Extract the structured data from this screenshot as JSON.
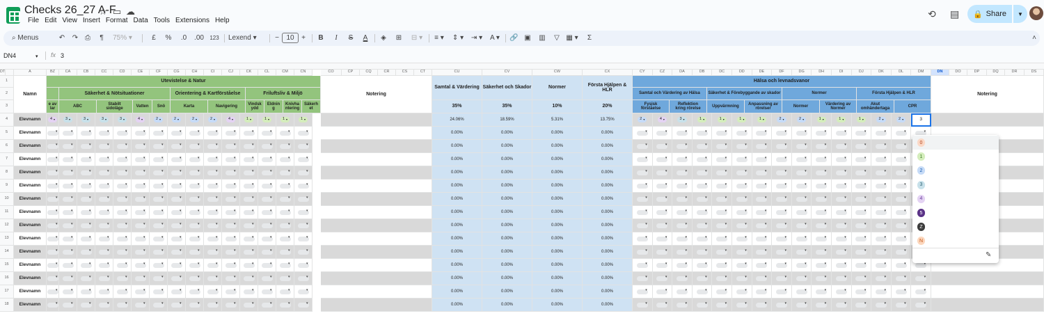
{
  "app": {
    "title": "Checks 26_27 A-F",
    "menus": [
      "File",
      "Edit",
      "View",
      "Insert",
      "Format",
      "Data",
      "Tools",
      "Extensions",
      "Help"
    ],
    "share_label": "Share"
  },
  "toolbar": {
    "search_label": "Menus",
    "zoom": "75%",
    "currency": "£",
    "percent": "%",
    "dec_less": ".0",
    "dec_more": ".00",
    "format_123": "123",
    "font": "Lexend",
    "font_size": "10",
    "bold": "B",
    "italic": "I",
    "strike": "S",
    "text_color": "A"
  },
  "formula": {
    "cell": "DN4",
    "fx": "fx",
    "value": "3"
  },
  "columns": [
    "BZ",
    "CA",
    "CB",
    "CC",
    "CD",
    "CE",
    "CF",
    "CG",
    "CH",
    "CI",
    "CJ",
    "CK",
    "CL",
    "CM",
    "CN",
    "CO",
    "CP",
    "CQ",
    "CR",
    "CS",
    "CT",
    "CU",
    "CV",
    "CW",
    "CX",
    "CY",
    "CZ",
    "DA",
    "DB",
    "DC",
    "DD",
    "DE",
    "DF",
    "DG",
    "DH",
    "DI",
    "DJ",
    "DK",
    "DL",
    "DM",
    "DN",
    "DO",
    "DP",
    "DQ",
    "DR",
    "DS",
    "DT"
  ],
  "colA": "A",
  "header": {
    "namn": "Namn",
    "notering": "Notering",
    "group1": "Utevistelse & Natur",
    "sub1": [
      "Säkerhet & Nötsituationer",
      "Orientering & Kartförståelse",
      "Friluftsliv & Miljö"
    ],
    "leaf1": [
      "e av\nlar",
      "ABC",
      "Stabilt\nsidoläge",
      "Vatten",
      "Snö",
      "Karta",
      "Navigering",
      "Vindsk\nydd",
      "Eldnin\ng",
      "Knivha\nntering",
      "Säkerh\net"
    ],
    "sum": [
      {
        "label": "Samtal & Värdering",
        "pct": "35%"
      },
      {
        "label": "Säkerhet och Skador",
        "pct": "35%"
      },
      {
        "label": "Normer",
        "pct": "10%"
      },
      {
        "label": "Första Hjälpen & HLR",
        "pct": "20%"
      }
    ],
    "group2": "Hälsa och levnadsvanor",
    "sub2": [
      "Samtal och Värdering av Hälsa",
      "Säkerhet & Förebyggande av skador",
      "Normer",
      "Första Hjälpen & HLR"
    ],
    "leaf2": [
      "Fysisk\nförståelse",
      "Reflektion\nkring rörelse",
      "Uppvärmning",
      "Anpassning av\nrörelser",
      "Normer",
      "Värdering av\nNormer",
      "Akut\nomhändertaga",
      "CPR"
    ]
  },
  "rows": [
    {
      "num": "4",
      "name": "Elevnamn",
      "left": [
        "4",
        "3",
        "3",
        "3",
        "3",
        "4",
        "2",
        "2",
        "2",
        "2",
        "4",
        "1",
        "1",
        "1",
        "1"
      ],
      "pct": [
        "24.06%",
        "18.59%",
        "5.31%",
        "13.75%"
      ],
      "right": [
        "2",
        "4",
        "3",
        "1",
        "1",
        "1",
        "1",
        "2",
        "2",
        "1",
        "1",
        "1",
        "2",
        "2",
        "3"
      ],
      "active": "3"
    },
    {
      "num": "5",
      "name": "Elevnamn",
      "pct": [
        "0.00%",
        "0.00%",
        "0.00%",
        "0.00%"
      ]
    },
    {
      "num": "6",
      "name": "Elevnamn",
      "pct": [
        "0.00%",
        "0.00%",
        "0.00%",
        "0.00%"
      ]
    },
    {
      "num": "7",
      "name": "Elevnamn",
      "pct": [
        "0.00%",
        "0.00%",
        "0.00%",
        "0.00%"
      ]
    },
    {
      "num": "8",
      "name": "Elevnamn",
      "pct": [
        "0.00%",
        "0.00%",
        "0.00%",
        "0.00%"
      ]
    },
    {
      "num": "9",
      "name": "Elevnamn",
      "pct": [
        "0.00%",
        "0.00%",
        "0.00%",
        "0.00%"
      ]
    },
    {
      "num": "10",
      "name": "Elevnamn",
      "pct": [
        "0.00%",
        "0.00%",
        "0.00%",
        "0.00%"
      ]
    },
    {
      "num": "11",
      "name": "Elevnamn",
      "pct": [
        "0.00%",
        "0.00%",
        "0.00%",
        "0.00%"
      ]
    },
    {
      "num": "12",
      "name": "Elevnamn",
      "pct": [
        "0.00%",
        "0.00%",
        "0.00%",
        "0.00%"
      ]
    },
    {
      "num": "13",
      "name": "Elevnamn",
      "pct": [
        "0.00%",
        "0.00%",
        "0.00%",
        "0.00%"
      ]
    },
    {
      "num": "14",
      "name": "Elevnamn",
      "pct": [
        "0.00%",
        "0.00%",
        "0.00%",
        "0.00%"
      ]
    },
    {
      "num": "15",
      "name": "Elevnamn",
      "pct": [
        "0.00%",
        "0.00%",
        "0.00%",
        "0.00%"
      ]
    },
    {
      "num": "16",
      "name": "Elevnamn",
      "pct": [
        "0.00%",
        "0.00%",
        "0.00%",
        "0.00%"
      ]
    },
    {
      "num": "17",
      "name": "Elevnamn",
      "pct": [
        "0.00%",
        "0.00%",
        "0.00%",
        "0.00%"
      ]
    },
    {
      "num": "18",
      "name": "Elevnamn",
      "pct": [
        "0.00%",
        "0.00%",
        "0.00%",
        "0.00%"
      ]
    }
  ],
  "dropdown": {
    "options": [
      {
        "v": "0",
        "bg": "#fbd9c7",
        "fg": "#b3441c"
      },
      {
        "v": "1",
        "bg": "#d4edbc",
        "fg": "#3c7d22"
      },
      {
        "v": "2",
        "bg": "#c6dbf7",
        "fg": "#1a5eb0"
      },
      {
        "v": "3",
        "bg": "#c8e1ea",
        "fg": "#2c6274"
      },
      {
        "v": "4",
        "bg": "#e4d3f3",
        "fg": "#6a3d9a"
      },
      {
        "v": "5",
        "bg": "#5a3286",
        "fg": "#ffffff"
      },
      {
        "v": "Z",
        "bg": "#3c3c3c",
        "fg": "#ffffff"
      },
      {
        "v": "N",
        "bg": "#fcd7bd",
        "fg": "#c4561a"
      }
    ]
  },
  "colors": {
    "green_header": "#93c47d",
    "blue_pct": "#cfe2f3",
    "blue_header": "#6fa8dc",
    "row_even": "#d9d9d9",
    "accent": "#0b57d0",
    "chip_purple": "#e4d3f3",
    "chip_blue": "#c6dbf7",
    "chip_green": "#d4edbc"
  }
}
